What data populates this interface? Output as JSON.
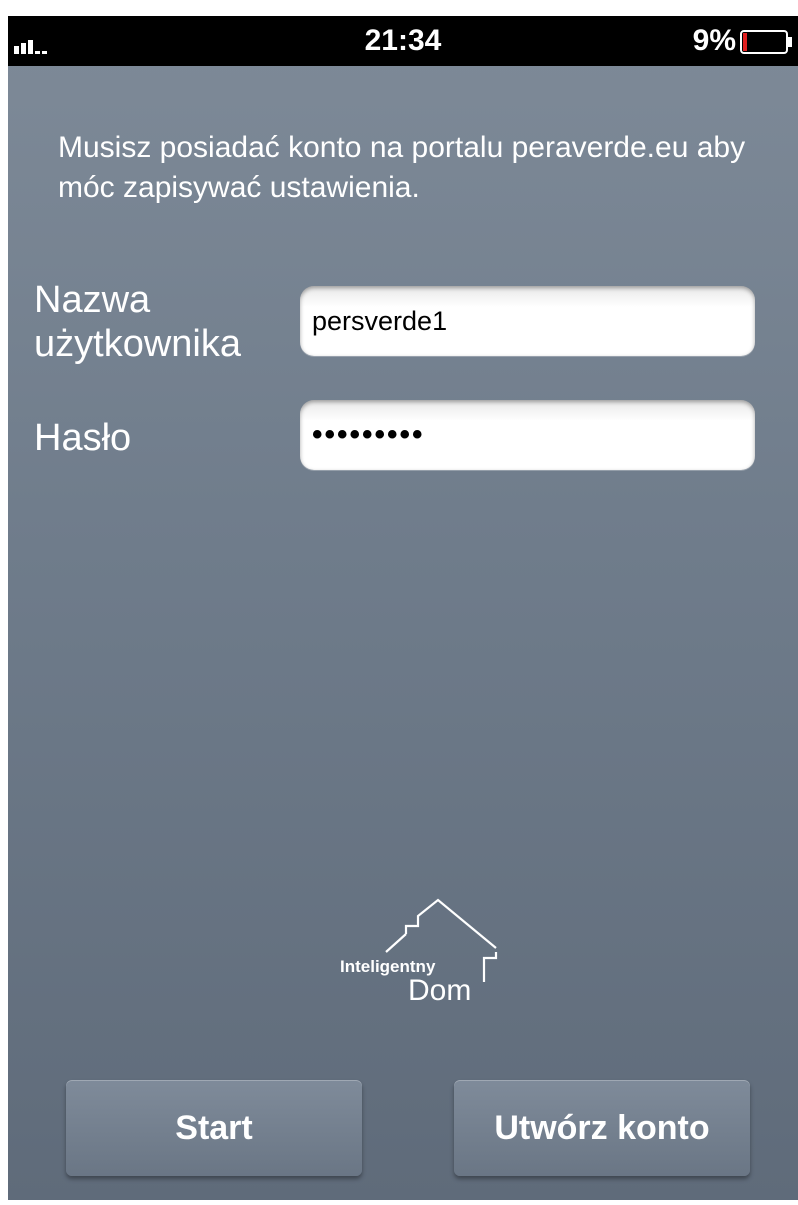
{
  "status_bar": {
    "time": "21:34",
    "battery_percent": "9%",
    "battery_level": 0.09,
    "battery_color": "#e02020"
  },
  "login": {
    "info": "Musisz posiadać konto na portalu peraverde.eu aby móc zapisywać ustawienia.",
    "username_label_line1": "Nazwa",
    "username_label_line2": "użytkownika",
    "username_value": "persverde1",
    "password_label": "Hasło",
    "password_value": "•••••••••"
  },
  "logo": {
    "line1": "Inteligentny",
    "line2": "Dom"
  },
  "buttons": {
    "start": "Start",
    "create_account": "Utwórz konto"
  },
  "colors": {
    "background_top": "#7e8a98",
    "background_bottom": "#5f6b7a",
    "status_bar": "#000000"
  }
}
